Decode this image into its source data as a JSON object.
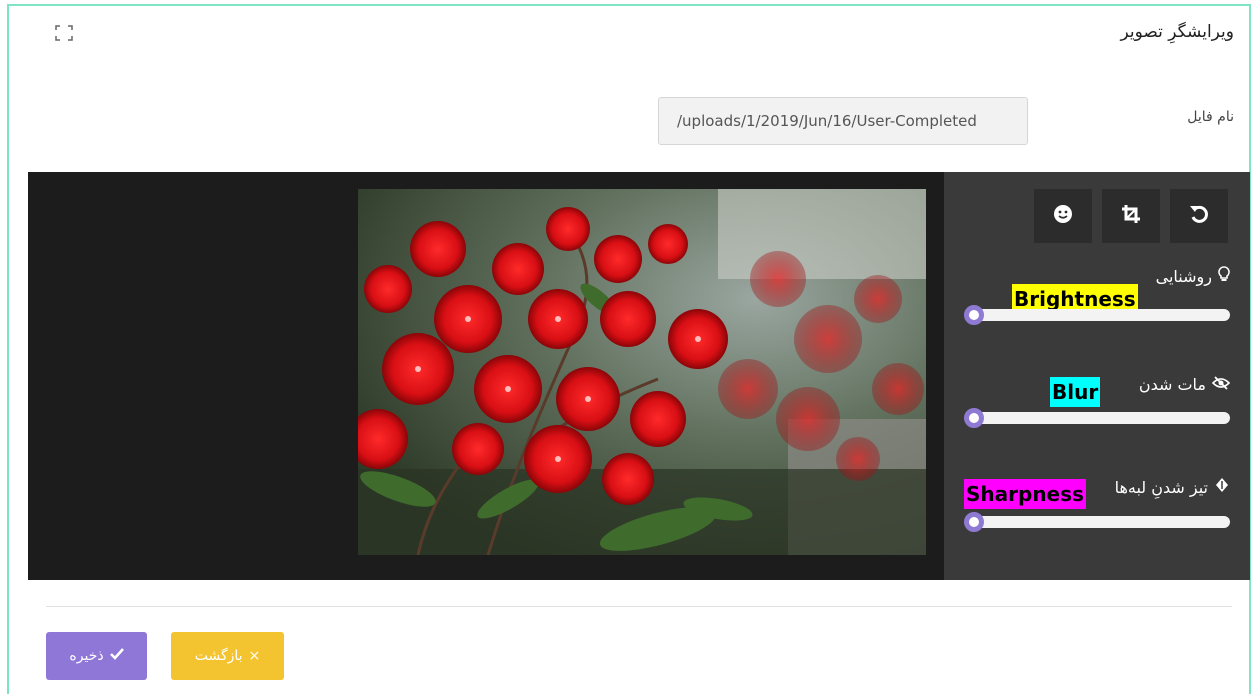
{
  "header": {
    "title": "ویرایشگرِ تصویر",
    "expand_icon": "expand-icon"
  },
  "file": {
    "label": "نام فایل",
    "value": "/uploads/1/2019/Jun/16/User-Completed"
  },
  "toolbar": {
    "tools": [
      "rotate-icon",
      "crop-icon",
      "emoji-icon"
    ]
  },
  "adjustments": {
    "brightness": {
      "label": "روشنایی",
      "tag": "Brightness",
      "tag_color": "#ffff00",
      "icon": "lightbulb-icon",
      "value": 0
    },
    "blur": {
      "label": "مات شدن",
      "tag": "Blur",
      "tag_color": "#00ffff",
      "icon": "eye-slash-icon",
      "value": 0
    },
    "sharpness": {
      "label": "تیز شدنِ لبه‌ها",
      "tag": "Sharpness",
      "tag_color": "#ff00ff",
      "icon": "sharpen-icon",
      "value": 0
    }
  },
  "actions": {
    "save_label": "ذخیره",
    "back_label": "بازگشت"
  },
  "colors": {
    "accent": "#8e77d6",
    "warning": "#f4c430",
    "frame": "#7fe3c6"
  }
}
